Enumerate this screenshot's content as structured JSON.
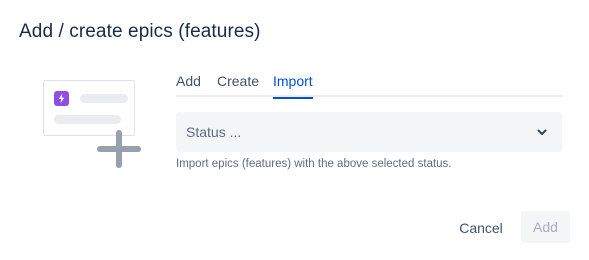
{
  "dialog": {
    "title": "Add / create epics (features)"
  },
  "illustration": {
    "badge_color": "#904ee2",
    "badge_icon": "bolt-icon",
    "plus_icon": "plus-icon"
  },
  "tabs": {
    "items": [
      {
        "label": "Add",
        "active": false
      },
      {
        "label": "Create",
        "active": false
      },
      {
        "label": "Import",
        "active": true
      }
    ],
    "active_color": "#0052cc"
  },
  "import": {
    "status_select": {
      "placeholder": "Status ...",
      "icon": "chevron-down-icon"
    },
    "helper_text": "Import epics (features) with the above selected status."
  },
  "footer": {
    "cancel_label": "Cancel",
    "add_label": "Add",
    "add_disabled": true
  }
}
